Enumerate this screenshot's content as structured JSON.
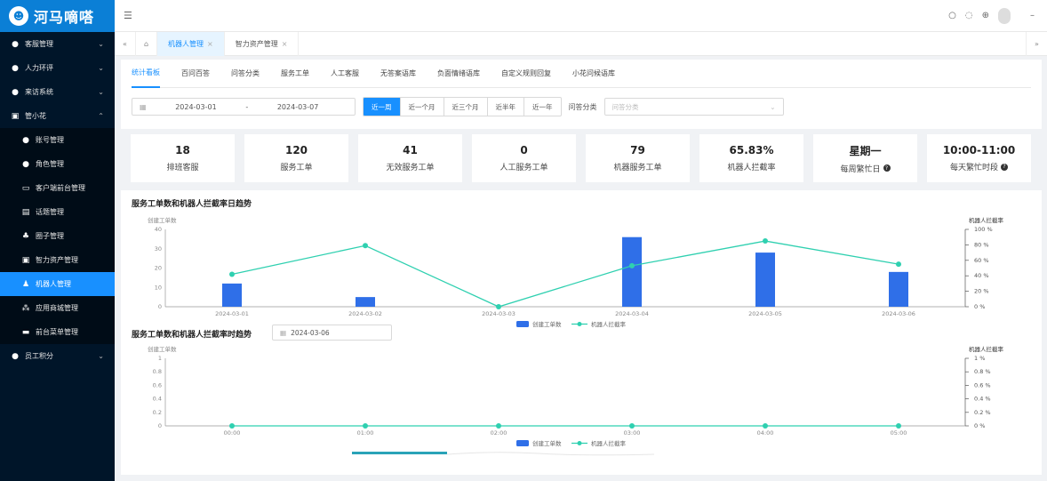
{
  "brand": {
    "name": "河马嘀嗒"
  },
  "colors": {
    "accent": "#1890ff",
    "bar": "#2f6fe8",
    "line": "#2fd0b0",
    "sidebar": "#001529"
  },
  "sidebar": {
    "items": [
      {
        "label": "客服管理",
        "icon": "user-icon",
        "expanded": false
      },
      {
        "label": "人力环评",
        "icon": "user-icon",
        "expanded": false
      },
      {
        "label": "来访系统",
        "icon": "user-icon",
        "expanded": false
      },
      {
        "label": "管小花",
        "icon": "grid-icon",
        "expanded": true
      }
    ],
    "sub_items": [
      {
        "label": "账号管理",
        "icon": "user-icon"
      },
      {
        "label": "角色管理",
        "icon": "user-icon"
      },
      {
        "label": "客户端前台管理",
        "icon": "monitor-icon"
      },
      {
        "label": "话题管理",
        "icon": "table-icon"
      },
      {
        "label": "圈子管理",
        "icon": "circle-icon"
      },
      {
        "label": "智力资产管理",
        "icon": "grid-icon"
      },
      {
        "label": "机器人管理",
        "icon": "robot-icon",
        "active": true
      },
      {
        "label": "应用商城管理",
        "icon": "apps-icon"
      },
      {
        "label": "前台菜单管理",
        "icon": "menu-icon"
      }
    ],
    "last_item": {
      "label": "员工积分",
      "icon": "user-icon"
    }
  },
  "tabs": [
    {
      "label": "机器人管理",
      "active": true
    },
    {
      "label": "智力资产管理",
      "active": false
    }
  ],
  "subtabs": [
    "统计看板",
    "百问百答",
    "问答分类",
    "服务工单",
    "人工客服",
    "无答案语库",
    "负面情绪语库",
    "自定义规则回复",
    "小花问候语库"
  ],
  "filters": {
    "start_date": "2024-03-01",
    "sep": "-",
    "end_date": "2024-03-07",
    "ranges": [
      "近一周",
      "近一个月",
      "近三个月",
      "近半年",
      "近一年"
    ],
    "category_label": "问答分类",
    "category_placeholder": "问答分类"
  },
  "stats": [
    {
      "value": "18",
      "label": "排班客服",
      "help": false
    },
    {
      "value": "120",
      "label": "服务工单",
      "help": false
    },
    {
      "value": "41",
      "label": "无效服务工单",
      "help": false
    },
    {
      "value": "0",
      "label": "人工服务工单",
      "help": false
    },
    {
      "value": "79",
      "label": "机器服务工单",
      "help": false
    },
    {
      "value": "65.83%",
      "label": "机器人拦截率",
      "help": false
    },
    {
      "value": "星期一",
      "label": "每周繁忙日",
      "help": true
    },
    {
      "value": "10:00-11:00",
      "label": "每天繁忙时段",
      "help": true
    }
  ],
  "chart_titles": {
    "daily": "服务工单数和机器人拦截率日趋势",
    "hourly": "服务工单数和机器人拦截率时趋势"
  },
  "hourly_date": "2024-03-06",
  "chart_data": [
    {
      "type": "bar",
      "title": "服务工单数和机器人拦截率日趋势",
      "categories": [
        "2024-03-01",
        "2024-03-02",
        "2024-03-03",
        "2024-03-04",
        "2024-03-05",
        "2024-03-06"
      ],
      "ylabel": "创建工单数",
      "y2label": "机器人拦截率",
      "ylim": [
        0,
        40
      ],
      "yticks": [
        "0",
        "10",
        "20",
        "30",
        "40"
      ],
      "y2lim": [
        0,
        100
      ],
      "y2ticks": [
        "0 %",
        "20 %",
        "40 %",
        "60 %",
        "80 %",
        "100 %"
      ],
      "series": [
        {
          "name": "创建工单数",
          "type": "bar",
          "axis": "left",
          "values": [
            12,
            5,
            0,
            36,
            28,
            18
          ]
        },
        {
          "name": "机器人拦截率",
          "type": "line",
          "axis": "right",
          "values": [
            42,
            79,
            0,
            53,
            85,
            55
          ]
        }
      ],
      "legend": "bottom"
    },
    {
      "type": "bar",
      "title": "服务工单数和机器人拦截率时趋势",
      "categories": [
        "00:00",
        "01:00",
        "02:00",
        "03:00",
        "04:00",
        "05:00"
      ],
      "ylabel": "创建工单数",
      "y2label": "机器人拦截率",
      "ylim": [
        0,
        1
      ],
      "yticks": [
        "0",
        "0.2",
        "0.4",
        "0.6",
        "0.8",
        "1"
      ],
      "y2lim": [
        0,
        1
      ],
      "y2ticks": [
        "0 %",
        "0.2 %",
        "0.4 %",
        "0.6 %",
        "0.8 %",
        "1 %"
      ],
      "series": [
        {
          "name": "创建工单数",
          "type": "bar",
          "axis": "left",
          "values": [
            0,
            0,
            0,
            0,
            0,
            0
          ]
        },
        {
          "name": "机器人拦截率",
          "type": "line",
          "axis": "right",
          "values": [
            0,
            0,
            0,
            0,
            0,
            0
          ]
        }
      ],
      "legend": "bottom",
      "zoom_slider": true
    }
  ]
}
